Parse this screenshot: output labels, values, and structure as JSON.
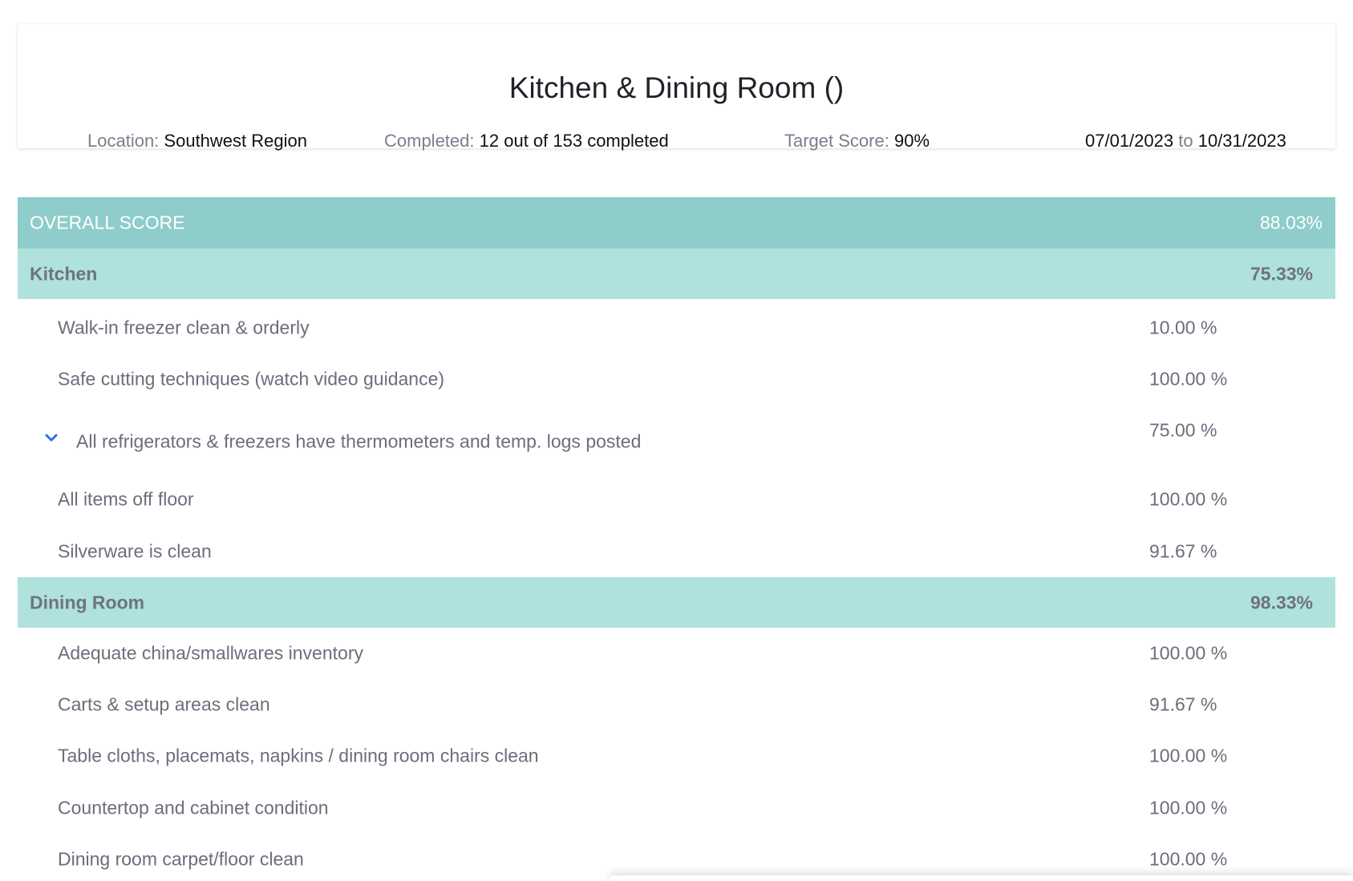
{
  "header": {
    "title": "Kitchen & Dining Room ()",
    "location_label": "Location:",
    "location_value": "Southwest Region",
    "completed_label": "Completed:",
    "completed_value": "12 out of 153 completed",
    "target_label": "Target Score:",
    "target_value": "90%",
    "date_start": "07/01/2023",
    "date_sep": "to",
    "date_end": "10/31/2023"
  },
  "overall": {
    "label": "OVERALL SCORE",
    "score": "88.03%"
  },
  "sections": [
    {
      "label": "Kitchen",
      "score": "75.33%",
      "items": [
        {
          "label": "Walk-in freezer clean & orderly",
          "score": "10.00 %"
        },
        {
          "label": "Safe cutting techniques (watch video guidance)",
          "score": "100.00 %"
        },
        {
          "label": "All refrigerators & freezers have thermometers and temp. logs posted",
          "score": "75.00 %",
          "icon": "chevron-down-icon"
        },
        {
          "label": "All items off floor",
          "score": "100.00 %"
        },
        {
          "label": "Silverware is clean",
          "score": "91.67 %"
        }
      ]
    },
    {
      "label": "Dining Room",
      "score": "98.33%",
      "items": [
        {
          "label": "Adequate china/smallwares inventory",
          "score": "100.00 %"
        },
        {
          "label": "Carts & setup areas clean",
          "score": "91.67 %"
        },
        {
          "label": "Table cloths, placemats, napkins / dining room chairs clean",
          "score": "100.00 %"
        },
        {
          "label": "Countertop and cabinet condition",
          "score": "100.00 %"
        },
        {
          "label": "Dining room carpet/floor clean",
          "score": "100.00 %"
        }
      ]
    }
  ],
  "colors": {
    "overall_bg": "#8ecdc9",
    "section_bg": "#afe2dc",
    "chevron": "#2f6fe0"
  }
}
